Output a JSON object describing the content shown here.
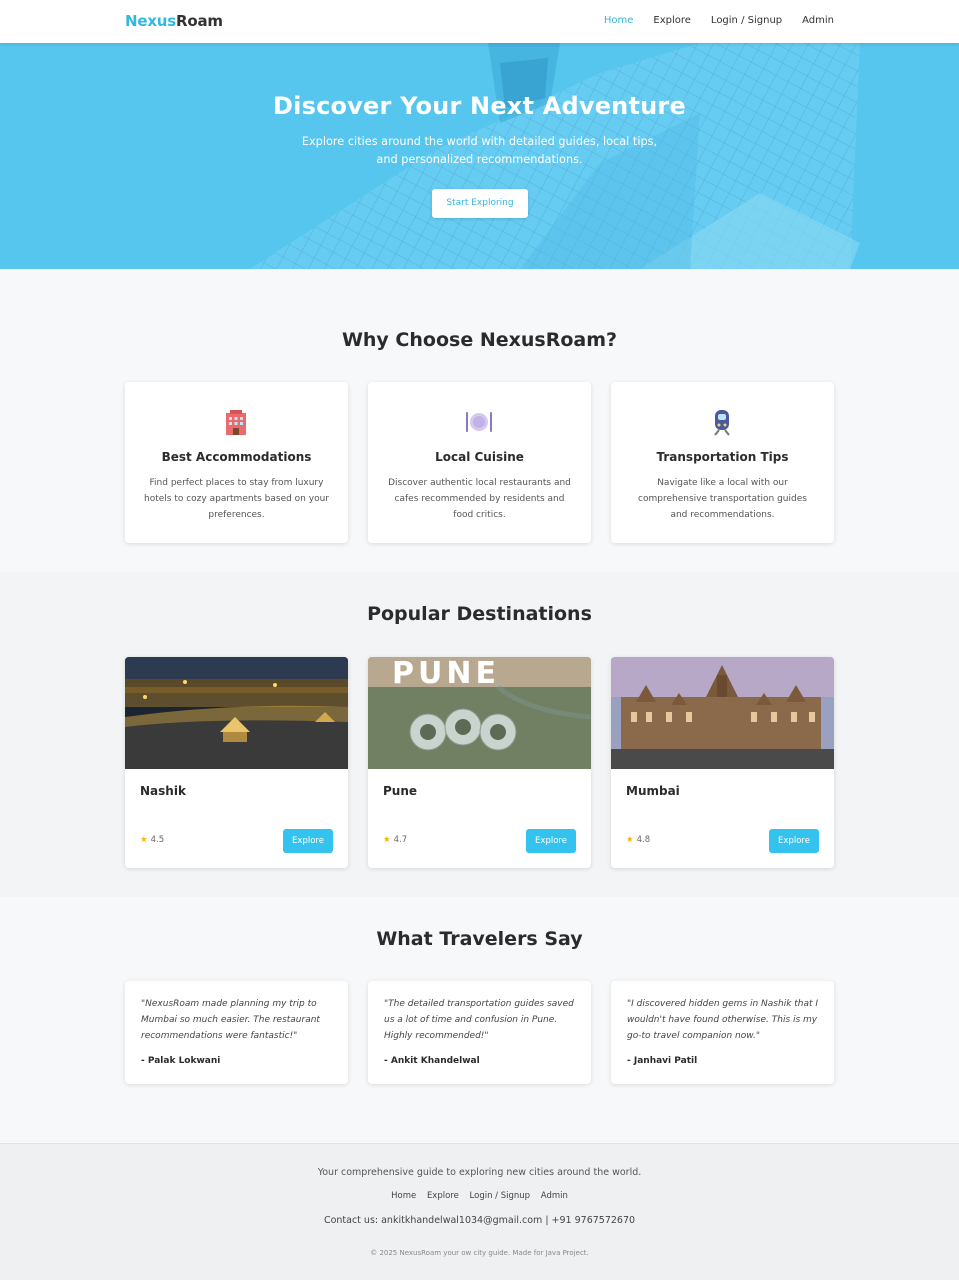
{
  "nav": {
    "brand_part1": "Nexus",
    "brand_part2": "Roam",
    "links": [
      "Home",
      "Explore",
      "Login / Signup",
      "Admin"
    ],
    "active": "Home"
  },
  "hero": {
    "title": "Discover Your Next Adventure",
    "subtitle": "Explore cities around the world with detailed guides, local tips, and personalized recommendations.",
    "cta": "Start Exploring"
  },
  "features": {
    "title": "Why Choose NexusRoam?",
    "items": [
      {
        "icon": "hotel-icon",
        "title": "Best Accommodations",
        "text": "Find perfect places to stay from luxury hotels to cozy apartments based on your preferences."
      },
      {
        "icon": "plate-utensils-icon",
        "title": "Local Cuisine",
        "text": "Discover authentic local restaurants and cafes recommended by residents and food critics."
      },
      {
        "icon": "train-icon",
        "title": "Transportation Tips",
        "text": "Navigate like a local with our comprehensive transportation guides and recommendations."
      }
    ]
  },
  "destinations": {
    "title": "Popular Destinations",
    "items": [
      {
        "name": "Nashik",
        "rating": "4.5",
        "button": "Explore",
        "image": "nashik-ghat-night-photo"
      },
      {
        "name": "Pune",
        "rating": "4.7",
        "button": "Explore",
        "image": "pune-aerial-photo",
        "image_text": "PUNE"
      },
      {
        "name": "Mumbai",
        "rating": "4.8",
        "button": "Explore",
        "image": "mumbai-cst-station-photo"
      }
    ]
  },
  "testimonials": {
    "title": "What Travelers Say",
    "items": [
      {
        "quote": "\"NexusRoam made planning my trip to Mumbai so much easier. The restaurant recommendations were fantastic!\"",
        "author": "- Palak Lokwani"
      },
      {
        "quote": "\"The detailed transportation guides saved us a lot of time and confusion in Pune. Highly recommended!\"",
        "author": "- Ankit Khandelwal"
      },
      {
        "quote": "\"I discovered hidden gems in Nashik that I wouldn't have found otherwise. This is my go-to travel companion now.\"",
        "author": "- Janhavi Patil"
      }
    ]
  },
  "footer": {
    "tagline": "Your comprehensive guide to exploring new cities around the world.",
    "links": [
      "Home",
      "Explore",
      "Login / Signup",
      "Admin"
    ],
    "contact": "Contact us: ankitkhandelwal1034@gmail.com | +91 9767572670",
    "copyright": "© 2025 NexusRoam your ow city guide. Made for Java Project."
  },
  "colors": {
    "accent": "#34b7e0",
    "hero_bg": "#51c3ec",
    "button": "#34c2ee",
    "star": "#f5b400"
  }
}
